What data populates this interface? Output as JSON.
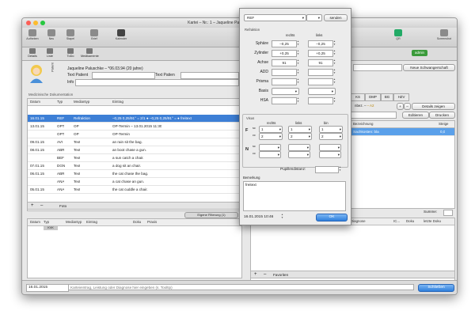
{
  "window": {
    "title": "Kartei – Nr.: 1 – Jaqueline Paluschke – *06.03.94 (20 jahre)"
  },
  "toolbar": {
    "items": [
      "Aufheben",
      "Neu",
      "Stapel",
      "Brief",
      "Kalender",
      "Labor",
      "QR",
      "Screenshot"
    ],
    "right_user": "admin"
  },
  "subtoolbar": {
    "items": [
      "Details",
      "Liste",
      "ToDo",
      "Medikamente"
    ]
  },
  "patient": {
    "header_label": "Patient",
    "name_line": "Jaqueline Paluschke – *06.03.94 (20 jahre)",
    "text_patient_label": "Text Patient",
    "text_patient_value": "",
    "info_label": "Info",
    "info_value": ""
  },
  "neue_schwangerschaft_button": "Neue Schwangerschaft",
  "med_doc": {
    "section_label": "Medizinische Dokumentation",
    "columns": [
      "Datum",
      "Typ",
      "Mediantyp",
      "Eintrag"
    ],
    "rows": [
      {
        "datum": "16.01.15",
        "typ": "REF",
        "mediantyp": "Refraktion",
        "eintrag": "–0,25 0,25/91° = 2/1 ● –0,25 0,25/91° = ● freitext",
        "selected": true
      },
      {
        "datum": "13.01.15",
        "typ": "OPT",
        "mediantyp": "OP",
        "eintrag": "OP-Termin – 13.01.2015 11:30"
      },
      {
        "datum": "",
        "typ": "OPT",
        "mediantyp": "OP",
        "eintrag": "OP-Termin"
      },
      {
        "datum": "09.01.15",
        "typ": "AVI",
        "mediantyp": "Text",
        "eintrag": "an rain sit the bag."
      },
      {
        "datum": "08.01.15",
        "typ": "ABR",
        "mediantyp": "Text",
        "eintrag": "an boot chase a gun."
      },
      {
        "datum": "",
        "typ": "BEF",
        "mediantyp": "Text",
        "eintrag": "a sun catch a chair."
      },
      {
        "datum": "07.01.15",
        "typ": "DGN",
        "mediantyp": "Text",
        "eintrag": "a dog sit an chair."
      },
      {
        "datum": "06.01.15",
        "typ": "ABR",
        "mediantyp": "Text",
        "eintrag": "the cat chase the bag."
      },
      {
        "datum": "",
        "typ": "ANA",
        "mediantyp": "Text",
        "eintrag": "a cat chase an gun."
      },
      {
        "datum": "05.01.15",
        "typ": "ANA",
        "mediantyp": "Text",
        "eintrag": "the cat cuddle a chair."
      }
    ],
    "add_button": "+",
    "remove_button": "–",
    "foto_label": "Foto"
  },
  "filter_button": "Eigene Filterung (1)",
  "lower_table": {
    "columns": [
      "Datum",
      "Typ",
      "Mediantyp",
      "Eintrag",
      "Doku",
      "Praxis"
    ],
    "first_typ": "KVK"
  },
  "right_panel": {
    "tabs": [
      "KS",
      "DMP",
      "BG",
      "HZV"
    ],
    "beh_label": "Behandlungsfall",
    "beh_value": "–  A2",
    "details_button": "Details zeigen",
    "editieren_button": "Editieren",
    "drucken_button": "Drucken",
    "col_bezeichnung": "Bezeichnung",
    "col_steige": "Steige",
    "first_row": "Sachkosten: bla",
    "first_row_value": "0,0",
    "summe_label": "Summe:",
    "diag_columns": [
      "Diagnose",
      "IC...",
      "Doku",
      "letzte Doku"
    ],
    "favoriten_label": "Favoriten"
  },
  "popup": {
    "type_select": "REF",
    "send_button": "senden",
    "refraktion_label": "Refraktion",
    "col_rechts": "rechts",
    "col_links": "links",
    "rows": [
      {
        "label": "Sphäre",
        "rechts": "–0,25",
        "links": "–0,25"
      },
      {
        "label": "Zylinder",
        "rechts": "+0,25",
        "links": "+0,25"
      },
      {
        "label": "Achse",
        "rechts": "91",
        "links": "91"
      },
      {
        "label": "ADD",
        "rechts": "",
        "links": ""
      },
      {
        "label": "Prisma",
        "rechts": "",
        "links": ""
      },
      {
        "label": "Basis",
        "rechts": "",
        "links": ""
      },
      {
        "label": "HSA",
        "rechts": "",
        "links": ""
      }
    ],
    "visus_label": "Visus",
    "visus_cols": [
      "rechts",
      "links",
      "bin"
    ],
    "visus_F": {
      "sc": [
        "1",
        "1",
        "1"
      ],
      "cc": [
        "2",
        "2",
        "2"
      ]
    },
    "visus_N": {
      "sc": [
        "",
        "",
        ""
      ],
      "cc": [
        "",
        "",
        ""
      ]
    },
    "pupillendistanz_label": "Pupillendistanz:",
    "pupillendistanz_value": "",
    "bemerkung_label": "Bemerkung",
    "bemerkung_value": "freitext",
    "date_value": "16.01.2015 10:46",
    "ok_button": "OK"
  },
  "bottom": {
    "date_value": "16.01.2015",
    "input_placeholder": "Karteieintrag, Leistung oder Diagnose hier eingeben (s. Tooltip)",
    "schliessen_button": "Schließen"
  },
  "colors": {
    "selection": "#3d7fd6",
    "accent_blue": "#2e7fdc",
    "highlight_row": "#5aa0ea"
  }
}
